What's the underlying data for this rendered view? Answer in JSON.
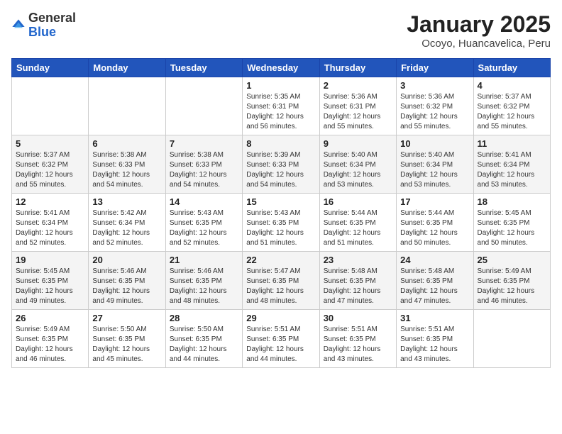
{
  "logo": {
    "general": "General",
    "blue": "Blue"
  },
  "header": {
    "title": "January 2025",
    "location": "Ocoyo, Huancavelica, Peru"
  },
  "days_of_week": [
    "Sunday",
    "Monday",
    "Tuesday",
    "Wednesday",
    "Thursday",
    "Friday",
    "Saturday"
  ],
  "weeks": [
    [
      {
        "day": "",
        "info": ""
      },
      {
        "day": "",
        "info": ""
      },
      {
        "day": "",
        "info": ""
      },
      {
        "day": "1",
        "info": "Sunrise: 5:35 AM\nSunset: 6:31 PM\nDaylight: 12 hours\nand 56 minutes."
      },
      {
        "day": "2",
        "info": "Sunrise: 5:36 AM\nSunset: 6:31 PM\nDaylight: 12 hours\nand 55 minutes."
      },
      {
        "day": "3",
        "info": "Sunrise: 5:36 AM\nSunset: 6:32 PM\nDaylight: 12 hours\nand 55 minutes."
      },
      {
        "day": "4",
        "info": "Sunrise: 5:37 AM\nSunset: 6:32 PM\nDaylight: 12 hours\nand 55 minutes."
      }
    ],
    [
      {
        "day": "5",
        "info": "Sunrise: 5:37 AM\nSunset: 6:32 PM\nDaylight: 12 hours\nand 55 minutes."
      },
      {
        "day": "6",
        "info": "Sunrise: 5:38 AM\nSunset: 6:33 PM\nDaylight: 12 hours\nand 54 minutes."
      },
      {
        "day": "7",
        "info": "Sunrise: 5:38 AM\nSunset: 6:33 PM\nDaylight: 12 hours\nand 54 minutes."
      },
      {
        "day": "8",
        "info": "Sunrise: 5:39 AM\nSunset: 6:33 PM\nDaylight: 12 hours\nand 54 minutes."
      },
      {
        "day": "9",
        "info": "Sunrise: 5:40 AM\nSunset: 6:34 PM\nDaylight: 12 hours\nand 53 minutes."
      },
      {
        "day": "10",
        "info": "Sunrise: 5:40 AM\nSunset: 6:34 PM\nDaylight: 12 hours\nand 53 minutes."
      },
      {
        "day": "11",
        "info": "Sunrise: 5:41 AM\nSunset: 6:34 PM\nDaylight: 12 hours\nand 53 minutes."
      }
    ],
    [
      {
        "day": "12",
        "info": "Sunrise: 5:41 AM\nSunset: 6:34 PM\nDaylight: 12 hours\nand 52 minutes."
      },
      {
        "day": "13",
        "info": "Sunrise: 5:42 AM\nSunset: 6:34 PM\nDaylight: 12 hours\nand 52 minutes."
      },
      {
        "day": "14",
        "info": "Sunrise: 5:43 AM\nSunset: 6:35 PM\nDaylight: 12 hours\nand 52 minutes."
      },
      {
        "day": "15",
        "info": "Sunrise: 5:43 AM\nSunset: 6:35 PM\nDaylight: 12 hours\nand 51 minutes."
      },
      {
        "day": "16",
        "info": "Sunrise: 5:44 AM\nSunset: 6:35 PM\nDaylight: 12 hours\nand 51 minutes."
      },
      {
        "day": "17",
        "info": "Sunrise: 5:44 AM\nSunset: 6:35 PM\nDaylight: 12 hours\nand 50 minutes."
      },
      {
        "day": "18",
        "info": "Sunrise: 5:45 AM\nSunset: 6:35 PM\nDaylight: 12 hours\nand 50 minutes."
      }
    ],
    [
      {
        "day": "19",
        "info": "Sunrise: 5:45 AM\nSunset: 6:35 PM\nDaylight: 12 hours\nand 49 minutes."
      },
      {
        "day": "20",
        "info": "Sunrise: 5:46 AM\nSunset: 6:35 PM\nDaylight: 12 hours\nand 49 minutes."
      },
      {
        "day": "21",
        "info": "Sunrise: 5:46 AM\nSunset: 6:35 PM\nDaylight: 12 hours\nand 48 minutes."
      },
      {
        "day": "22",
        "info": "Sunrise: 5:47 AM\nSunset: 6:35 PM\nDaylight: 12 hours\nand 48 minutes."
      },
      {
        "day": "23",
        "info": "Sunrise: 5:48 AM\nSunset: 6:35 PM\nDaylight: 12 hours\nand 47 minutes."
      },
      {
        "day": "24",
        "info": "Sunrise: 5:48 AM\nSunset: 6:35 PM\nDaylight: 12 hours\nand 47 minutes."
      },
      {
        "day": "25",
        "info": "Sunrise: 5:49 AM\nSunset: 6:35 PM\nDaylight: 12 hours\nand 46 minutes."
      }
    ],
    [
      {
        "day": "26",
        "info": "Sunrise: 5:49 AM\nSunset: 6:35 PM\nDaylight: 12 hours\nand 46 minutes."
      },
      {
        "day": "27",
        "info": "Sunrise: 5:50 AM\nSunset: 6:35 PM\nDaylight: 12 hours\nand 45 minutes."
      },
      {
        "day": "28",
        "info": "Sunrise: 5:50 AM\nSunset: 6:35 PM\nDaylight: 12 hours\nand 44 minutes."
      },
      {
        "day": "29",
        "info": "Sunrise: 5:51 AM\nSunset: 6:35 PM\nDaylight: 12 hours\nand 44 minutes."
      },
      {
        "day": "30",
        "info": "Sunrise: 5:51 AM\nSunset: 6:35 PM\nDaylight: 12 hours\nand 43 minutes."
      },
      {
        "day": "31",
        "info": "Sunrise: 5:51 AM\nSunset: 6:35 PM\nDaylight: 12 hours\nand 43 minutes."
      },
      {
        "day": "",
        "info": ""
      }
    ]
  ]
}
